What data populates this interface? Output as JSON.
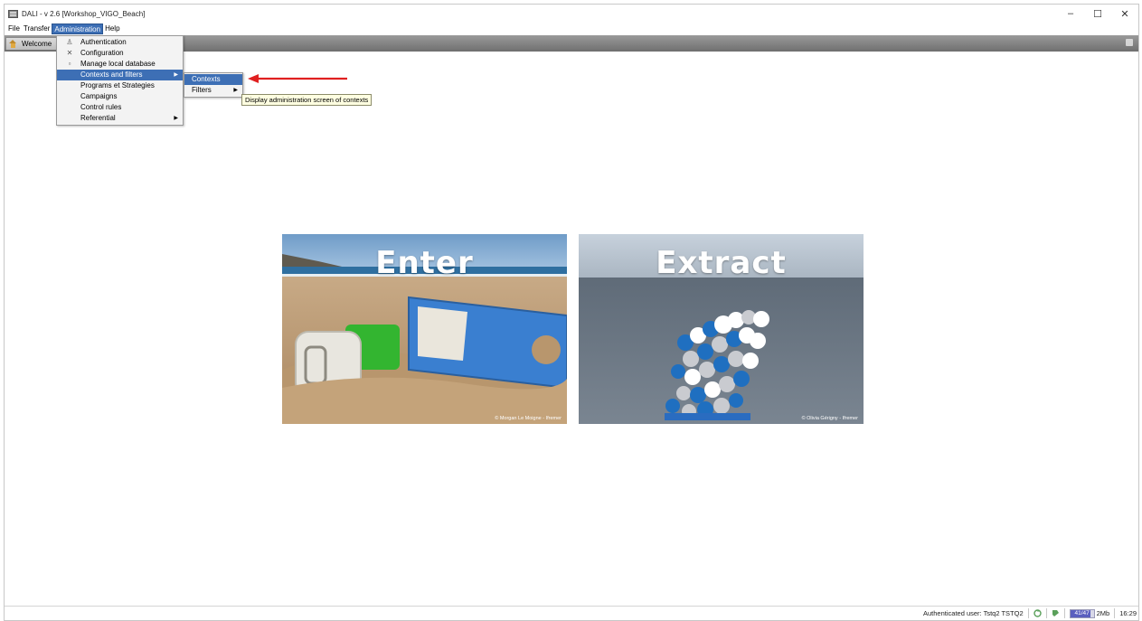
{
  "window": {
    "title": "DALI - v 2.6 [Workshop_VIGO_Beach]",
    "controls": {
      "minimize": "–",
      "maximize": "☐",
      "close": "✕"
    }
  },
  "menubar": {
    "items": [
      {
        "label": "File"
      },
      {
        "label": "Transfer"
      },
      {
        "label": "Administration"
      },
      {
        "label": "Help"
      }
    ]
  },
  "toolbar": {
    "tab_label": "Welcome"
  },
  "admin_menu": {
    "items": [
      {
        "label": "Authentication",
        "icon": "user-key-icon"
      },
      {
        "label": "Configuration",
        "icon": "wrench-icon"
      },
      {
        "label": "Manage local database",
        "icon": "database-icon"
      },
      {
        "label": "Contexts and filters",
        "has_submenu": true,
        "highlighted": true
      },
      {
        "label": "Programs et Strategies"
      },
      {
        "label": "Campaigns"
      },
      {
        "label": "Control rules"
      },
      {
        "label": "Referential",
        "has_submenu": true
      }
    ]
  },
  "submenu": {
    "items": [
      {
        "label": "Contexts",
        "highlighted": true
      },
      {
        "label": "Filters",
        "has_submenu": true
      }
    ]
  },
  "tooltip": {
    "text": "Display administration screen of contexts"
  },
  "tiles": {
    "enter": {
      "title": "Enter",
      "credit": "© Morgan Le Moigne - Ifremer"
    },
    "extract": {
      "title": "Extract",
      "credit": "© Olivia Gérigny - Ifremer"
    }
  },
  "statusbar": {
    "user_text": "Authenticated user: Tstq2 TSTQ2",
    "memory_label": "41/47",
    "memory_unit": "2Mb",
    "memory_fraction": 0.87,
    "time": "16:29"
  },
  "colors": {
    "highlight": "#3d6fb5",
    "arrow": "#e02020",
    "tooltip_bg": "#ffffe1"
  }
}
